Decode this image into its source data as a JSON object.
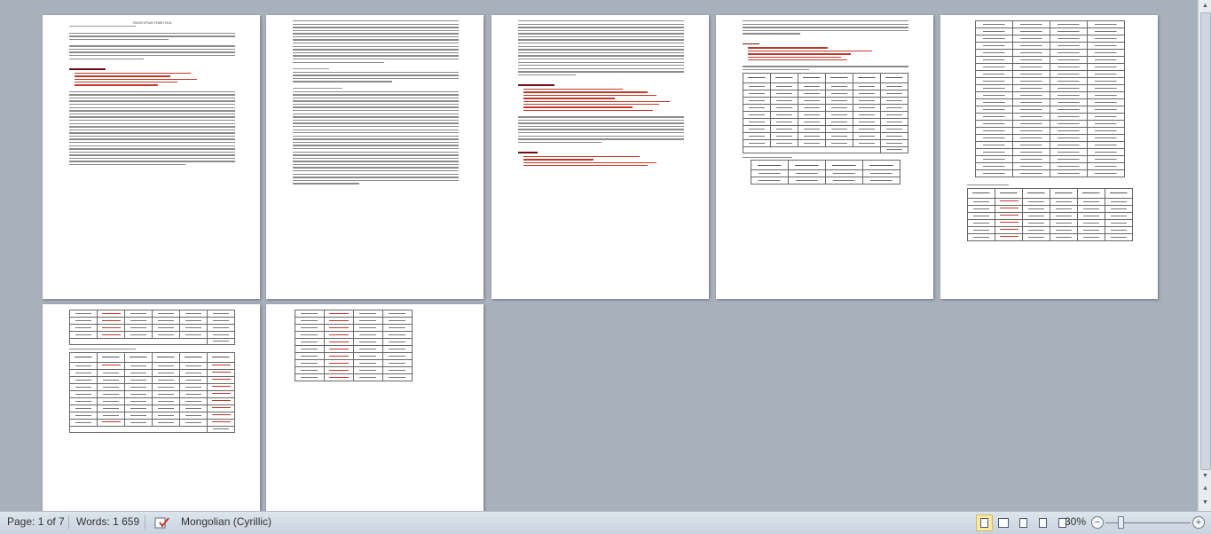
{
  "status": {
    "page": "Page: 1 of 7",
    "words": "Words: 1 659",
    "language": "Mongolian (Cyrillic)",
    "zoom": "30%",
    "zoom_out": "−",
    "zoom_in": "+"
  },
  "document": {
    "page1_title": "ТӨСӨЛ ОРЧИН ҮЕИЙН ҮЗЭЛ"
  },
  "colors": {
    "workspace": "#a8b0bb",
    "statusbar": "#d3dbe5",
    "accent_red": "#c0392b"
  }
}
